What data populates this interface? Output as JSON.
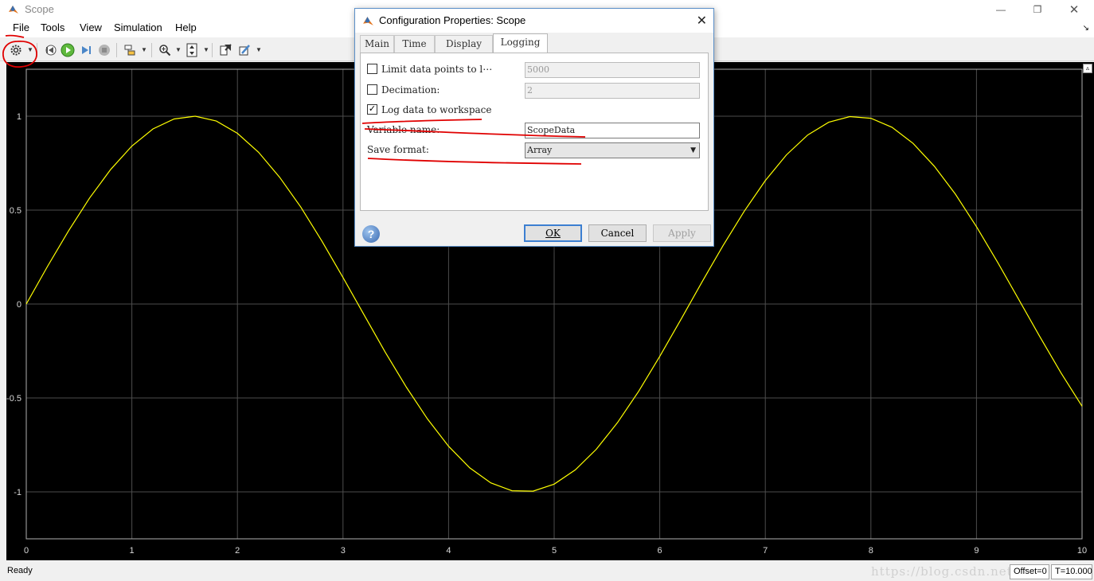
{
  "window": {
    "title": "Scope"
  },
  "menu": {
    "items": [
      "File",
      "Tools",
      "View",
      "Simulation",
      "Help"
    ]
  },
  "toolbar": {
    "icons": [
      "settings-icon",
      "step-back-icon",
      "run-icon",
      "step-forward-icon",
      "stop-icon",
      "highlight-block-icon",
      "zoom-icon",
      "scale-axes-icon",
      "restore-layout-icon",
      "style-icon"
    ]
  },
  "dialog": {
    "title": "Configuration Properties: Scope",
    "tabs": [
      "Main",
      "Time",
      "Display",
      "Logging"
    ],
    "active_tab": "Logging",
    "limit_label": "Limit data points to l⋯",
    "limit_value": "5000",
    "limit_checked": false,
    "decimation_label": "Decimation:",
    "decimation_value": "2",
    "decimation_checked": false,
    "log_label": "Log data to workspace",
    "log_checked": true,
    "varname_label": "Variable name:",
    "varname_value": "ScopeData",
    "format_label": "Save format:",
    "format_value": "Array",
    "buttons": {
      "ok": "OK",
      "cancel": "Cancel",
      "apply": "Apply"
    },
    "help": "?"
  },
  "status": {
    "text": "Ready",
    "offset": "Offset=0",
    "time": "T=10.000",
    "watermark": "https://blog.csdn.net/"
  },
  "colors": {
    "plot_bg": "#000000",
    "signal": "#ffff00",
    "grid": "#4d4d4d",
    "annotation": "#e00000"
  },
  "chart_data": {
    "type": "line",
    "title": "",
    "xlabel": "",
    "ylabel": "",
    "xlim": [
      0,
      10
    ],
    "ylim": [
      -1.25,
      1.25
    ],
    "xticks": [
      0,
      1,
      2,
      3,
      4,
      5,
      6,
      7,
      8,
      9,
      10
    ],
    "yticks": [
      -1,
      -0.5,
      0,
      0.5,
      1
    ],
    "xtick_labels": [
      "0",
      "1",
      "2",
      "3",
      "4",
      "5",
      "6",
      "7",
      "8",
      "9",
      "10"
    ],
    "ytick_labels": [
      "-1",
      "-0.5",
      "0",
      "0.5",
      "1"
    ],
    "grid": true,
    "series": [
      {
        "color": "#ffff00",
        "x": [
          0,
          0.2,
          0.4,
          0.6,
          0.8,
          1.0,
          1.2,
          1.4,
          1.6,
          1.8,
          2.0,
          2.2,
          2.4,
          2.6,
          2.8,
          3.0,
          3.2,
          3.4,
          3.6,
          3.8,
          4.0,
          4.2,
          4.4,
          4.6,
          4.8,
          5.0,
          5.2,
          5.4,
          5.6,
          5.8,
          6.0,
          6.2,
          6.4,
          6.6,
          6.8,
          7.0,
          7.2,
          7.4,
          7.6,
          7.8,
          8.0,
          8.2,
          8.4,
          8.6,
          8.8,
          9.0,
          9.2,
          9.4,
          9.6,
          9.8,
          10.0
        ],
        "y": [
          0,
          0.199,
          0.389,
          0.565,
          0.717,
          0.841,
          0.932,
          0.985,
          1.0,
          0.974,
          0.909,
          0.808,
          0.675,
          0.516,
          0.335,
          0.141,
          -0.058,
          -0.256,
          -0.443,
          -0.612,
          -0.757,
          -0.872,
          -0.952,
          -0.994,
          -0.996,
          -0.959,
          -0.883,
          -0.773,
          -0.631,
          -0.465,
          -0.279,
          -0.083,
          0.117,
          0.312,
          0.494,
          0.657,
          0.794,
          0.899,
          0.968,
          0.998,
          0.989,
          0.941,
          0.855,
          0.734,
          0.585,
          0.412,
          0.223,
          0.025,
          -0.174,
          -0.366,
          -0.544
        ]
      }
    ]
  }
}
